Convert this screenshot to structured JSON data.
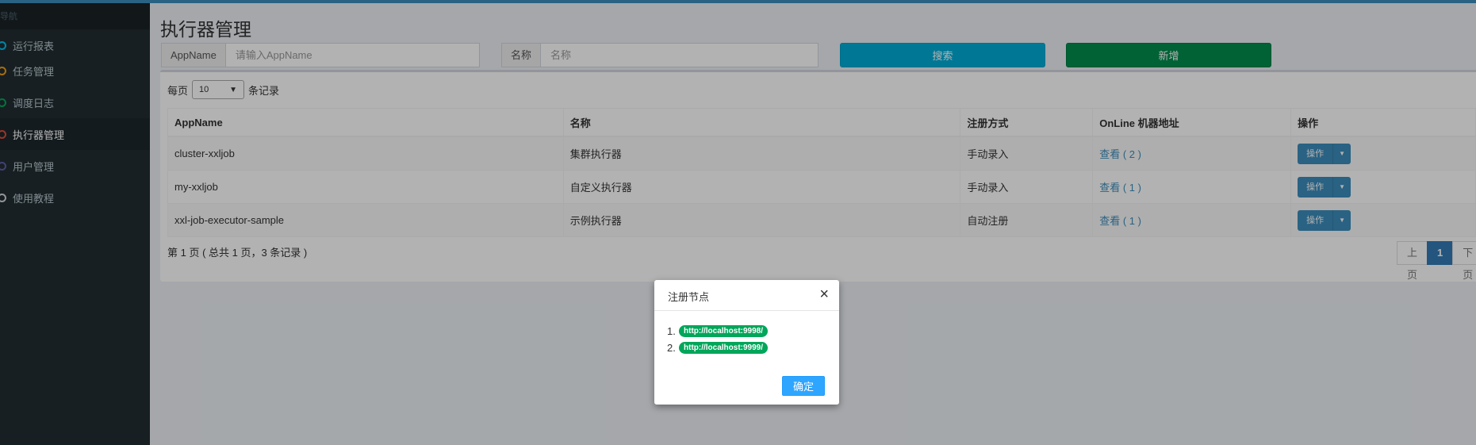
{
  "sidebar": {
    "header": "导航",
    "items": [
      {
        "label": "运行报表",
        "dot": "#00c0ef",
        "active": false
      },
      {
        "label": "任务管理",
        "dot": "#f39c12",
        "active": false
      },
      {
        "label": "调度日志",
        "dot": "#00a65a",
        "active": false
      },
      {
        "label": "执行器管理",
        "dot": "#dd4b39",
        "active": true
      },
      {
        "label": "用户管理",
        "dot": "#605ca8",
        "active": false
      },
      {
        "label": "使用教程",
        "dot": "#d2d6de",
        "active": false
      }
    ]
  },
  "main": {
    "title": "执行器管理",
    "filter_appname": {
      "label": "AppName",
      "placeholder": "请输入AppName"
    },
    "filter_name": {
      "label": "名称",
      "placeholder": "名称"
    },
    "search_label": "搜索",
    "add_label": "新增"
  },
  "table": {
    "length_prefix": "每页",
    "length_value": "10",
    "length_suffix": "条记录",
    "headers": [
      "AppName",
      "名称",
      "注册方式",
      "OnLine 机器地址",
      "操作"
    ],
    "rows": [
      {
        "appname": "cluster-xxljob",
        "name": "集群执行器",
        "mode": "手动录入",
        "online": "查看 ( 2 )",
        "op": "操作"
      },
      {
        "appname": "my-xxljob",
        "name": "自定义执行器",
        "mode": "手动录入",
        "online": "查看 ( 1 )",
        "op": "操作"
      },
      {
        "appname": "xxl-job-executor-sample",
        "name": "示例执行器",
        "mode": "自动注册",
        "online": "查看 ( 1 )",
        "op": "操作"
      }
    ],
    "info": "第 1 页 ( 总共 1 页，3 条记录 )",
    "pager": {
      "prev": "上页",
      "current": "1",
      "next": "下页"
    }
  },
  "dialog": {
    "title": "注册节点",
    "close": "×",
    "nodes": [
      {
        "num": "1.",
        "address": "http://localhost:9998/"
      },
      {
        "num": "2.",
        "address": "http://localhost:9999/"
      }
    ],
    "ok_label": "确定"
  },
  "colors": {
    "accent": "#3c8dbc",
    "search_button": "#00acd6",
    "add_button": "#008d4c",
    "node_badge": "#00a65a",
    "sidebar_bg": "#222d32"
  }
}
